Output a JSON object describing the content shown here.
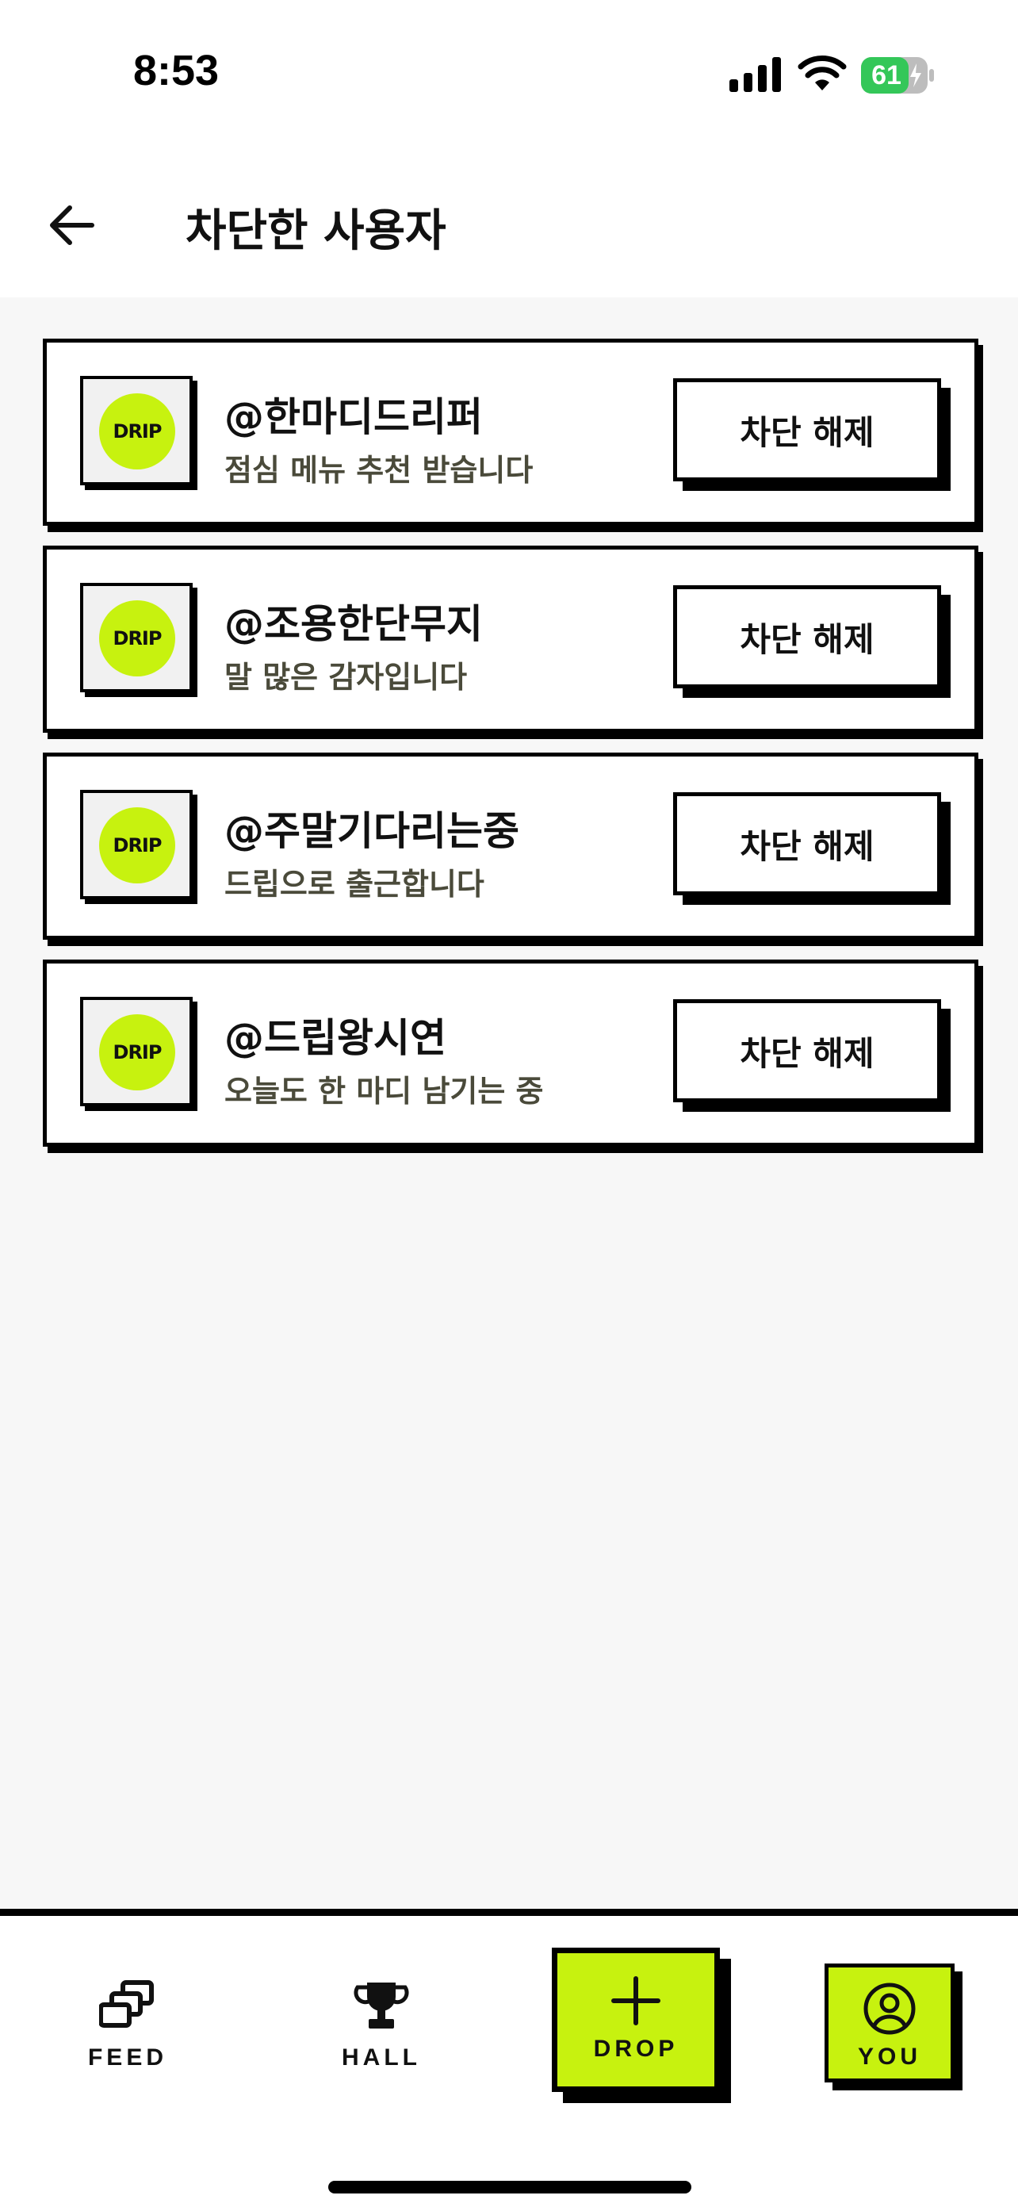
{
  "status_bar": {
    "time": "8:53",
    "battery_level": "61",
    "battery_color": "#34c759"
  },
  "header": {
    "back_icon": "arrow-left-icon",
    "title": "차단한 사용자"
  },
  "blocked_users": [
    {
      "avatar_text": "DRIP",
      "name": "@한마디드리퍼",
      "bio": "점심 메뉴 추천 받습니다",
      "button_label": "차단 해제"
    },
    {
      "avatar_text": "DRIP",
      "name": "@조용한단무지",
      "bio": "말 많은 감자입니다",
      "button_label": "차단 해제"
    },
    {
      "avatar_text": "DRIP",
      "name": "@주말기다리는중",
      "bio": "드립으로 출근합니다",
      "button_label": "차단 해제"
    },
    {
      "avatar_text": "DRIP",
      "name": "@드립왕시연",
      "bio": "오늘도 한 마디 남기는 중",
      "button_label": "차단 해제"
    }
  ],
  "tabbar": {
    "tabs": [
      {
        "label": "FEED",
        "icon": "stacked-cards-icon"
      },
      {
        "label": "HALL",
        "icon": "trophy-icon"
      },
      {
        "label": "DROP",
        "icon": "plus-icon"
      },
      {
        "label": "YOU",
        "icon": "user-circle-icon"
      }
    ]
  },
  "colors": {
    "accent": "#c7f20f",
    "content_background": "#f7f7f7",
    "border": "#000000"
  }
}
